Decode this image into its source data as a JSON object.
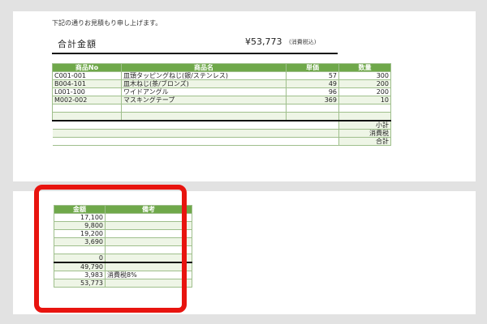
{
  "quote": {
    "intro": "下記の通りお見積もり申し上げます。",
    "total_label": "合計金額",
    "total_value": "¥53,773",
    "tax_note": "(消費税込)"
  },
  "items_table": {
    "headers": [
      "商品No",
      "商品名",
      "単価",
      "数量"
    ],
    "rows": [
      [
        "C001-001",
        "皿頭タッピングねじ(銀/ステンレス)",
        "57",
        "300"
      ],
      [
        "B004-101",
        "皿木ねじ(茶/ブロンズ)",
        "49",
        "200"
      ],
      [
        "L001-100",
        "ワイドアングル",
        "96",
        "200"
      ],
      [
        "M002-002",
        "マスキングテープ",
        "369",
        "10"
      ]
    ],
    "summary_labels": [
      "小計",
      "消費税",
      "合計"
    ]
  },
  "amount_table": {
    "headers": [
      "金額",
      "備考"
    ],
    "rows": [
      [
        "17,100",
        ""
      ],
      [
        "9,800",
        ""
      ],
      [
        "19,200",
        ""
      ],
      [
        "3,690",
        ""
      ],
      [
        "",
        ""
      ],
      [
        "0",
        ""
      ]
    ],
    "summary": [
      [
        "49,790",
        ""
      ],
      [
        "3,983",
        "消費税8%"
      ],
      [
        "53,773",
        ""
      ]
    ]
  },
  "colors": {
    "header_green": "#6fa84a",
    "row_shade": "#eef5e6",
    "highlight_red": "#e8140f"
  }
}
